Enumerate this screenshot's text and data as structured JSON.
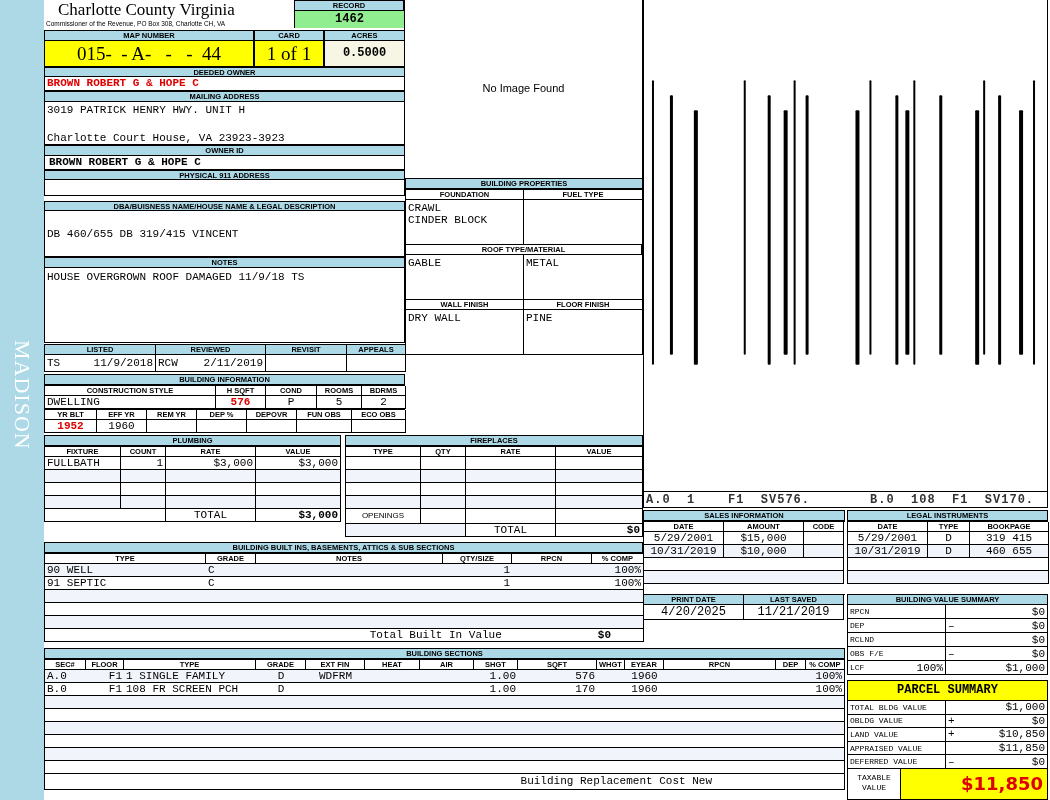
{
  "sidebar": {
    "label": "MADISON"
  },
  "header": {
    "title": "Charlotte County Virginia",
    "subtitle": "Commissioner of the Revenue, PO Box 308, Charlotte CH, VA"
  },
  "record": {
    "label": "RECORD",
    "value": "1462"
  },
  "parcel_ids": [
    {
      "label": "MAP NUMBER",
      "value": "015-  - A-   -   -  44",
      "kind": "map"
    },
    {
      "label": "CARD",
      "value": "1 of 1",
      "kind": "card"
    },
    {
      "label": "ACRES",
      "value": "0.5000",
      "kind": "acres"
    }
  ],
  "deeded_owner": {
    "label": "DEEDED OWNER",
    "value": "BROWN ROBERT G & HOPE C"
  },
  "mailing_address": {
    "label": "MAILING ADDRESS",
    "lines": [
      "3019 PATRICK HENRY HWY. UNIT H",
      "Charlotte Court House, VA 23923-3923"
    ]
  },
  "owner_id": {
    "label": "OWNER ID",
    "value": "BROWN ROBERT G & HOPE C"
  },
  "physical_address": {
    "label": "PHYSICAL 911 ADDRESS"
  },
  "legal_description": {
    "label": "DBA/BUISNESS NAME/HOUSE NAME & LEGAL DESCRIPTION",
    "value": "DB 460/655 DB 319/415 VINCENT"
  },
  "notes": {
    "label": "NOTES",
    "value": "HOUSE OVERGROWN ROOF DAMAGED 11/9/18 TS"
  },
  "review": [
    {
      "label": "LISTED",
      "initials": "TS",
      "date": "11/9/2018"
    },
    {
      "label": "REVIEWED",
      "initials": "RCW",
      "date": "2/11/2019"
    },
    {
      "label": "REVISIT"
    },
    {
      "label": "APPEALS"
    }
  ],
  "building_information": {
    "title": "BUILDING INFORMATION",
    "row_1": [
      {
        "label": "CONSTRUCTION STYLE",
        "value": "DWELLING",
        "highlight": false
      },
      {
        "label": "H SQFT",
        "value": "576",
        "highlight": true
      },
      {
        "label": "COND",
        "value": "P",
        "highlight": false
      },
      {
        "label": "ROOMS",
        "value": "5",
        "highlight": false
      },
      {
        "label": "BDRMS",
        "value": "2",
        "highlight": false
      }
    ],
    "row_2": [
      {
        "label": "YR BLT",
        "value": "1952",
        "highlight": true
      },
      {
        "label": "EFF YR",
        "value": "1960",
        "highlight": false
      },
      {
        "label": "REM YR"
      },
      {
        "label": "DEP %"
      },
      {
        "label": "DEPOVR"
      },
      {
        "label": "FUN OBS"
      },
      {
        "label": "ECO OBS"
      }
    ]
  },
  "photo": {
    "text": "No Image Found"
  },
  "building_properties": {
    "title": "BUILDING PROPERTIES",
    "foundation": {
      "label": "FOUNDATION",
      "lines": [
        "CRAWL",
        "CINDER BLOCK"
      ]
    },
    "fuel_type": {
      "label": "FUEL TYPE"
    },
    "roof": {
      "label": "ROOF TYPE/MATERIAL",
      "type": "GABLE",
      "material": "METAL"
    },
    "wall_finish": {
      "label": "WALL FINISH",
      "value": "DRY WALL"
    },
    "floor_finish": {
      "label": "FLOOR FINISH",
      "value": "PINE"
    }
  },
  "sketch": {
    "labels": [
      "A.0  1    F1  SV576.",
      "B.0  108  F1  SV170."
    ]
  },
  "plumbing": {
    "title": "PLUMBING",
    "columns": [
      "FIXTURE",
      "COUNT",
      "RATE",
      "VALUE"
    ],
    "rows": [
      [
        "FULLBATH",
        "1",
        "$3,000",
        "$3,000"
      ]
    ],
    "total_label": "TOTAL",
    "total": "$3,000"
  },
  "fireplaces": {
    "title": "FIREPLACES",
    "columns": [
      "TYPE",
      "QTY",
      "RATE",
      "VALUE"
    ],
    "openings_label": "OPENINGS",
    "total_label": "TOTAL",
    "total": "$0"
  },
  "sales": {
    "title": "SALES INFORMATION",
    "columns": [
      "DATE",
      "AMOUNT",
      "CODE"
    ],
    "rows": [
      [
        "5/29/2001",
        "$15,000"
      ],
      [
        "10/31/2019",
        "$10,000"
      ]
    ]
  },
  "legal_instruments": {
    "title": "LEGAL INSTRUMENTS",
    "columns": [
      "DATE",
      "TYPE",
      "BOOKPAGE"
    ],
    "rows": [
      [
        "5/29/2001",
        "D",
        "319 415"
      ],
      [
        "10/31/2019",
        "D",
        "460 655"
      ]
    ]
  },
  "dates": [
    {
      "label": "PRINT DATE",
      "value": "4/20/2025"
    },
    {
      "label": "LAST SAVED",
      "value": "11/21/2019"
    }
  ],
  "building_value_summary": {
    "title": "BUILDING VALUE SUMMARY",
    "rows": [
      {
        "label": "RPCN",
        "value": "$0"
      },
      {
        "label": "DEP",
        "sign": "–",
        "value": "$0"
      },
      {
        "label": "RCLND",
        "value": "$0"
      },
      {
        "label": "OBS F/E",
        "sign": "–",
        "value": "$0"
      },
      {
        "label": "LCF",
        "percent": "100%",
        "value": "$1,000"
      }
    ]
  },
  "built_ins": {
    "title": "BUILDING BUILT INS, BASEMENTS, ATTICS & SUB SECTIONS",
    "columns": [
      "TYPE",
      "GRADE",
      "NOTES",
      "QTY/SIZE",
      "RPCN",
      "% COMP"
    ],
    "rows": [
      {
        "type": "90 WELL",
        "grade": "C",
        "qty": "1",
        "comp": "100%"
      },
      {
        "type": "91 SEPTIC",
        "grade": "C",
        "qty": "1",
        "comp": "100%"
      }
    ],
    "total_label": "Total Built In Value",
    "total": "$0"
  },
  "building_sections": {
    "title": "BUILDING SECTIONS",
    "columns": [
      "SEC#",
      "FLOOR",
      "TYPE",
      "GRADE",
      "EXT FIN",
      "HEAT",
      "AIR",
      "SHGT",
      "SQFT",
      "WHGT",
      "EYEAR",
      "RPCN",
      "DEP",
      "% COMP"
    ],
    "rows": [
      {
        "sec": "A.0",
        "floor": "F1",
        "type": "1 SINGLE FAMILY",
        "grade": "D",
        "ext_fin": "WDFRM",
        "shgt": "1.00",
        "sqft": "576",
        "eyear": "1960",
        "comp": "100%"
      },
      {
        "sec": "B.0",
        "floor": "F1",
        "type": "108 FR SCREEN PCH",
        "grade": "D",
        "shgt": "1.00",
        "sqft": "170",
        "eyear": "1960",
        "comp": "100%"
      }
    ],
    "footer": "Building Replacement Cost New"
  },
  "parcel_summary": {
    "title": "PARCEL SUMMARY",
    "rows": [
      {
        "label": "TOTAL BLDG VALUE",
        "value": "$1,000"
      },
      {
        "label": "OBLDG VALUE",
        "sign": "+",
        "value": "$0"
      },
      {
        "label": "LAND VALUE",
        "sign": "+",
        "value": "$10,850"
      },
      {
        "label": "APPRAISED VALUE",
        "value": "$11,850"
      },
      {
        "label": "DEFERRED VALUE",
        "sign": "–",
        "value": "$0"
      }
    ],
    "taxable_label": "TAXABLE VALUE",
    "taxable_value": "$11,850"
  }
}
